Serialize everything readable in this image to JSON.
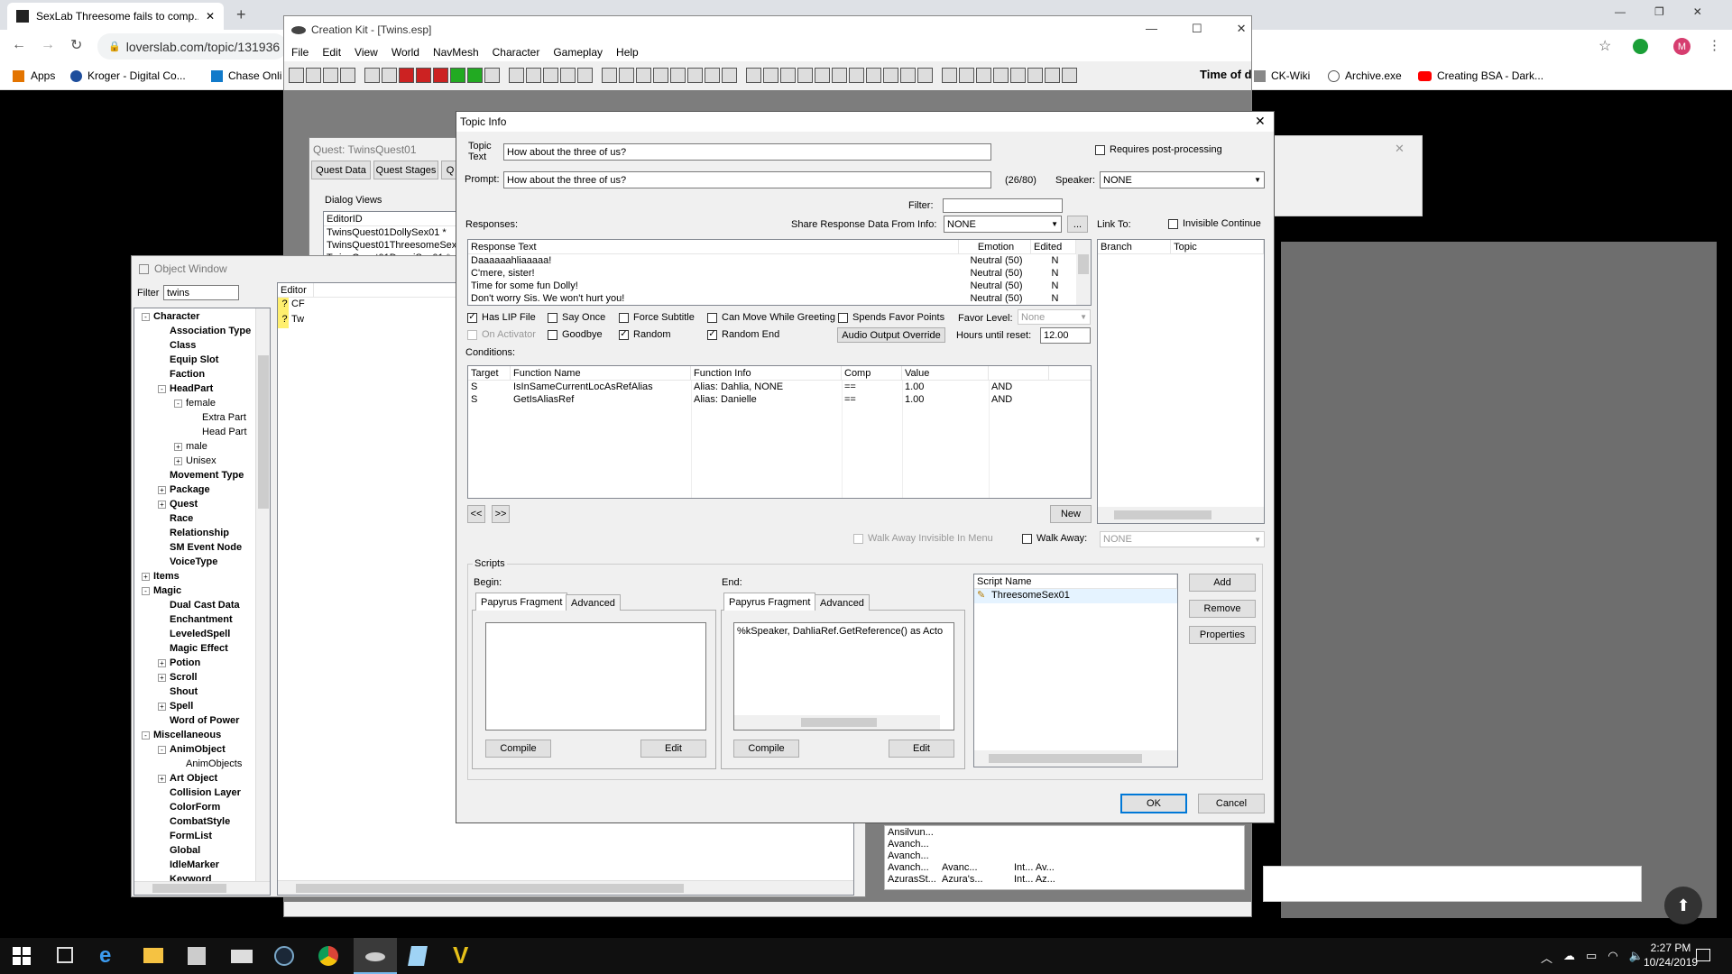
{
  "browser": {
    "tab_title": "SexLab Threesome fails to comp...",
    "new_tab": "+",
    "url": "loverslab.com/topic/131936",
    "bookmarks": [
      "Apps",
      "Kroger - Digital Co...",
      "Chase Onli",
      "CK-Wiki",
      "Archive.exe",
      "Creating BSA - Dark..."
    ],
    "avatar": "M"
  },
  "ck": {
    "title": "Creation Kit - [Twins.esp]",
    "menu": [
      "File",
      "Edit",
      "View",
      "World",
      "NavMesh",
      "Character",
      "Gameplay",
      "Help"
    ],
    "time_label": "Time of d"
  },
  "quest": {
    "title": "Quest: TwinsQuest01",
    "tabs": [
      "Quest Data",
      "Quest Stages",
      "Q"
    ],
    "dialog_views": "Dialog Views",
    "col_editor": "EditorID",
    "rows": [
      "TwinsQuest01DollySex01 *",
      "TwinsQuest01ThreesomeSex",
      "TwinsQuest01DanniSex01 *"
    ]
  },
  "object_window": {
    "title": "Object Window",
    "filter_label": "Filter",
    "filter_value": "twins",
    "col_editor": "Editor",
    "entries": [
      "CF",
      "Tw"
    ],
    "tree": [
      {
        "t": "Character",
        "lv": 0,
        "g": "-"
      },
      {
        "t": "Association Type",
        "lv": 1
      },
      {
        "t": "Class",
        "lv": 1
      },
      {
        "t": "Equip Slot",
        "lv": 1
      },
      {
        "t": "Faction",
        "lv": 1
      },
      {
        "t": "HeadPart",
        "lv": 1,
        "g": "-"
      },
      {
        "t": "female",
        "lv": 2,
        "g": "-"
      },
      {
        "t": "Extra Part",
        "lv": 3
      },
      {
        "t": "Head Part",
        "lv": 3
      },
      {
        "t": "male",
        "lv": 2,
        "g": "+"
      },
      {
        "t": "Unisex",
        "lv": 2,
        "g": "+"
      },
      {
        "t": "Movement Type",
        "lv": 1
      },
      {
        "t": "Package",
        "lv": 1,
        "g": "+"
      },
      {
        "t": "Quest",
        "lv": 1,
        "g": "+"
      },
      {
        "t": "Race",
        "lv": 1
      },
      {
        "t": "Relationship",
        "lv": 1
      },
      {
        "t": "SM Event Node",
        "lv": 1
      },
      {
        "t": "VoiceType",
        "lv": 1
      },
      {
        "t": "Items",
        "lv": 0,
        "g": "+"
      },
      {
        "t": "Magic",
        "lv": 0,
        "g": "-"
      },
      {
        "t": "Dual Cast Data",
        "lv": 1
      },
      {
        "t": "Enchantment",
        "lv": 1
      },
      {
        "t": "LeveledSpell",
        "lv": 1
      },
      {
        "t": "Magic Effect",
        "lv": 1
      },
      {
        "t": "Potion",
        "lv": 1,
        "g": "+"
      },
      {
        "t": "Scroll",
        "lv": 1,
        "g": "+"
      },
      {
        "t": "Shout",
        "lv": 1
      },
      {
        "t": "Spell",
        "lv": 1,
        "g": "+"
      },
      {
        "t": "Word of Power",
        "lv": 1
      },
      {
        "t": "Miscellaneous",
        "lv": 0,
        "g": "-"
      },
      {
        "t": "AnimObject",
        "lv": 1,
        "g": "-"
      },
      {
        "t": "AnimObjects",
        "lv": 2
      },
      {
        "t": "Art Object",
        "lv": 1,
        "g": "+"
      },
      {
        "t": "Collision Layer",
        "lv": 1
      },
      {
        "t": "ColorForm",
        "lv": 1
      },
      {
        "t": "CombatStyle",
        "lv": 1
      },
      {
        "t": "FormList",
        "lv": 1
      },
      {
        "t": "Global",
        "lv": 1
      },
      {
        "t": "IdleMarker",
        "lv": 1
      },
      {
        "t": "Keyword",
        "lv": 1
      }
    ]
  },
  "bg_list": {
    "rows": [
      [
        "Ansilvun...",
        "",
        ""
      ],
      [
        "Avanch...",
        "",
        ""
      ],
      [
        "Avanch...",
        "",
        ""
      ],
      [
        "Avanch...",
        "Avanc...",
        "Int...  Av..."
      ],
      [
        "AzurasSt...",
        "Azura's...",
        "Int...  Az..."
      ]
    ]
  },
  "topic": {
    "title": "Topic Info",
    "topic_text_label": "Topic Text",
    "topic_text": "How about the three of us?",
    "requires_post": "Requires post-processing",
    "prompt_label": "Prompt:",
    "prompt": "How about the three of us?",
    "count": "(26/80)",
    "speaker_label": "Speaker:",
    "speaker": "NONE",
    "filter_label": "Filter:",
    "responses_label": "Responses:",
    "share_label": "Share Response Data From Info:",
    "share_value": "NONE",
    "ellipsis": "...",
    "link_to": "Link To:",
    "invisible_continue": "Invisible Continue",
    "resp_cols": [
      "Response Text",
      "Emotion",
      "Edited"
    ],
    "responses": [
      [
        "Daaaaaahliaaaaa!",
        "Neutral (50)",
        "N"
      ],
      [
        "C'mere, sister!",
        "Neutral (50)",
        "N"
      ],
      [
        "Time for some fun Dolly!",
        "Neutral (50)",
        "N"
      ],
      [
        "Don't worry Sis. We won't hurt you!",
        "Neutral (50)",
        "N"
      ]
    ],
    "link_cols": [
      "Branch",
      "Topic"
    ],
    "cb": {
      "has_lip": "Has LIP File",
      "say_once": "Say Once",
      "force_sub": "Force Subtitle",
      "can_move": "Can Move While Greeting",
      "spends_favor": "Spends Favor Points",
      "favor_level": "Favor Level:",
      "favor_value": "None",
      "on_activator": "On Activator",
      "goodbye": "Goodbye",
      "random": "Random",
      "random_end": "Random End",
      "audio_override": "Audio Output Override",
      "hours_label": "Hours until reset:",
      "hours_value": "12.00"
    },
    "conditions_label": "Conditions:",
    "cond_cols": [
      "Target",
      "Function Name",
      "Function Info",
      "Comp",
      "Value",
      ""
    ],
    "conditions": [
      [
        "S",
        "IsInSameCurrentLocAsRefAlias",
        "Alias: Dahlia, NONE",
        "==",
        "1.00",
        "AND"
      ],
      [
        "S",
        "GetIsAliasRef",
        "Alias: Danielle",
        "==",
        "1.00",
        "AND"
      ]
    ],
    "prev": "<<",
    "next": ">>",
    "new": "New",
    "walk_away_invis": "Walk Away Invisible In Menu",
    "walk_away": "Walk Away:",
    "walk_away_value": "NONE",
    "scripts_label": "Scripts",
    "begin": "Begin:",
    "end": "End:",
    "papyrus_tab": "Papyrus Fragment",
    "advanced_tab": "Advanced",
    "end_code": "%kSpeaker, DahliaRef.GetReference() as Acto",
    "compile": "Compile",
    "edit": "Edit",
    "script_name_col": "Script Name",
    "script_name": "ThreesomeSex01",
    "add": "Add",
    "remove": "Remove",
    "properties": "Properties",
    "ok": "OK",
    "cancel": "Cancel"
  },
  "taskbar": {
    "time": "2:27 PM",
    "date": "10/24/2019"
  }
}
